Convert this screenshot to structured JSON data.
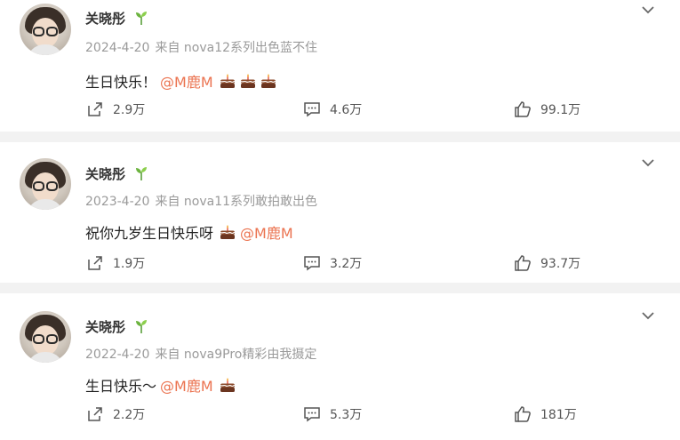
{
  "colors": {
    "mention": "#eb7350",
    "meta": "#9a9a9a",
    "background": "#f2f2f2"
  },
  "posts": [
    {
      "username": "关晓彤",
      "date": "2024-4-20",
      "source": "来自 nova12系列出色蓝不住",
      "text": "生日快乐！",
      "mention": "@M鹿M",
      "cakes": 3,
      "reposts": "2.9万",
      "comments": "4.6万",
      "likes": "99.1万"
    },
    {
      "username": "关晓彤",
      "date": "2023-4-20",
      "source": "来自 nova11系列敢拍敢出色",
      "text": "祝你九岁生日快乐呀",
      "mention": "@M鹿M",
      "cakes": 1,
      "reposts": "1.9万",
      "comments": "3.2万",
      "likes": "93.7万"
    },
    {
      "username": "关晓彤",
      "date": "2022-4-20",
      "source": "来自 nova9Pro精彩由我摄定",
      "text": "生日快乐～",
      "mention": "@M鹿M",
      "cakes": 1,
      "reposts": "2.2万",
      "comments": "5.3万",
      "likes": "181万"
    }
  ],
  "icons": {
    "share": "share-icon",
    "comment": "comment-icon",
    "like": "thumbs-up-icon",
    "menu": "chevron-down-icon",
    "badge": "sprout-icon",
    "emoji": "cake-icon"
  }
}
